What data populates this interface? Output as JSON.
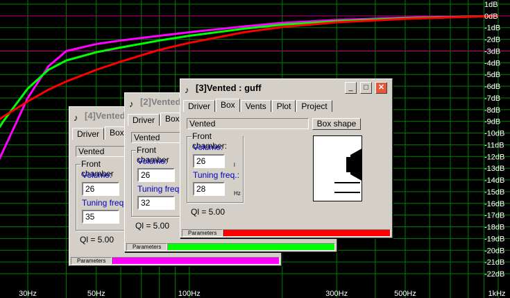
{
  "chart_data": {
    "type": "line",
    "x_scale": "log",
    "x_ticks": [
      "30Hz",
      "50Hz",
      "100Hz",
      "300Hz",
      "500Hz",
      "1kHz"
    ],
    "x_tick_values": [
      30,
      50,
      100,
      300,
      500,
      1000
    ],
    "y_ticks": [
      "1dB",
      "0dB",
      "-1dB",
      "-2dB",
      "-3dB",
      "-4dB",
      "-5dB",
      "-6dB",
      "-7dB",
      "-8dB",
      "-9dB",
      "-10dB",
      "-11dB",
      "-12dB",
      "-13dB",
      "-14dB",
      "-15dB",
      "-16dB",
      "-17dB",
      "-18dB",
      "-19dB",
      "-20dB",
      "-21dB",
      "-22dB"
    ],
    "ylim": [
      -22,
      1
    ],
    "grid": true,
    "colors": {
      "grid": "#008000",
      "axis_line": "#c00080",
      "tick_text": "#ffffff"
    },
    "series": [
      {
        "color": "#ff00ff",
        "x": [
          20,
          25,
          30,
          35,
          40,
          50,
          60,
          80,
          100,
          150,
          200,
          300,
          500,
          1000
        ],
        "y": [
          -17,
          -11.5,
          -7,
          -4.3,
          -3,
          -2.4,
          -2.1,
          -1.7,
          -1.4,
          -0.9,
          -0.6,
          -0.35,
          -0.15,
          0
        ]
      },
      {
        "color": "#00ff00",
        "x": [
          20,
          25,
          30,
          35,
          40,
          50,
          60,
          80,
          100,
          150,
          200,
          300,
          500,
          1000
        ],
        "y": [
          -13,
          -9,
          -6.2,
          -4.6,
          -3.8,
          -3.1,
          -2.7,
          -2.1,
          -1.7,
          -1.1,
          -0.75,
          -0.45,
          -0.2,
          0
        ]
      },
      {
        "color": "#ff0000",
        "x": [
          20,
          25,
          30,
          35,
          40,
          50,
          60,
          80,
          100,
          150,
          200,
          300,
          500,
          1000
        ],
        "y": [
          -10.5,
          -8.6,
          -7.3,
          -6.3,
          -5.6,
          -4.6,
          -3.9,
          -2.9,
          -2.3,
          -1.4,
          -0.95,
          -0.55,
          -0.25,
          0
        ]
      }
    ]
  },
  "windows": {
    "w4": {
      "title": "[4]Vented",
      "tabs": [
        "Driver",
        "Box"
      ],
      "type_value": "Vented",
      "group_label": "Front chamber",
      "volume_label": "Volume:",
      "volume_value": "26",
      "tuning_label": "Tuning freq.:",
      "tuning_value": "35",
      "ql": "Ql = 5.00",
      "status_label": "Parameters",
      "status_color": "#ff00ff"
    },
    "w2": {
      "title": "[2]Vented",
      "tabs": [
        "Driver",
        "Box"
      ],
      "type_value": "Vented",
      "group_label": "Front chamber",
      "volume_label": "Volume:",
      "volume_value": "26",
      "tuning_label": "Tuning freq.:",
      "tuning_value": "32",
      "ql": "Ql = 5.00",
      "status_label": "Parameters",
      "status_color": "#00ff00"
    },
    "w3": {
      "title": "[3]Vented : guff",
      "tabs": [
        "Driver",
        "Box",
        "Vents",
        "Plot",
        "Project"
      ],
      "type_value": "Vented",
      "box_shape_button": "Box shape",
      "group_label": "Front chamber:",
      "volume_label": "Volume:",
      "volume_value": "26",
      "volume_unit": "l",
      "tuning_label": "Tuning freq.:",
      "tuning_value": "28",
      "tuning_unit": "Hz",
      "ql": "Ql = 5.00",
      "status_label": "Parameters",
      "status_color": "#ff0000"
    }
  },
  "icons": {
    "app": "speaker-app-icon",
    "minimize": "minimize-icon",
    "maximize": "maximize-icon",
    "close": "close-icon"
  }
}
